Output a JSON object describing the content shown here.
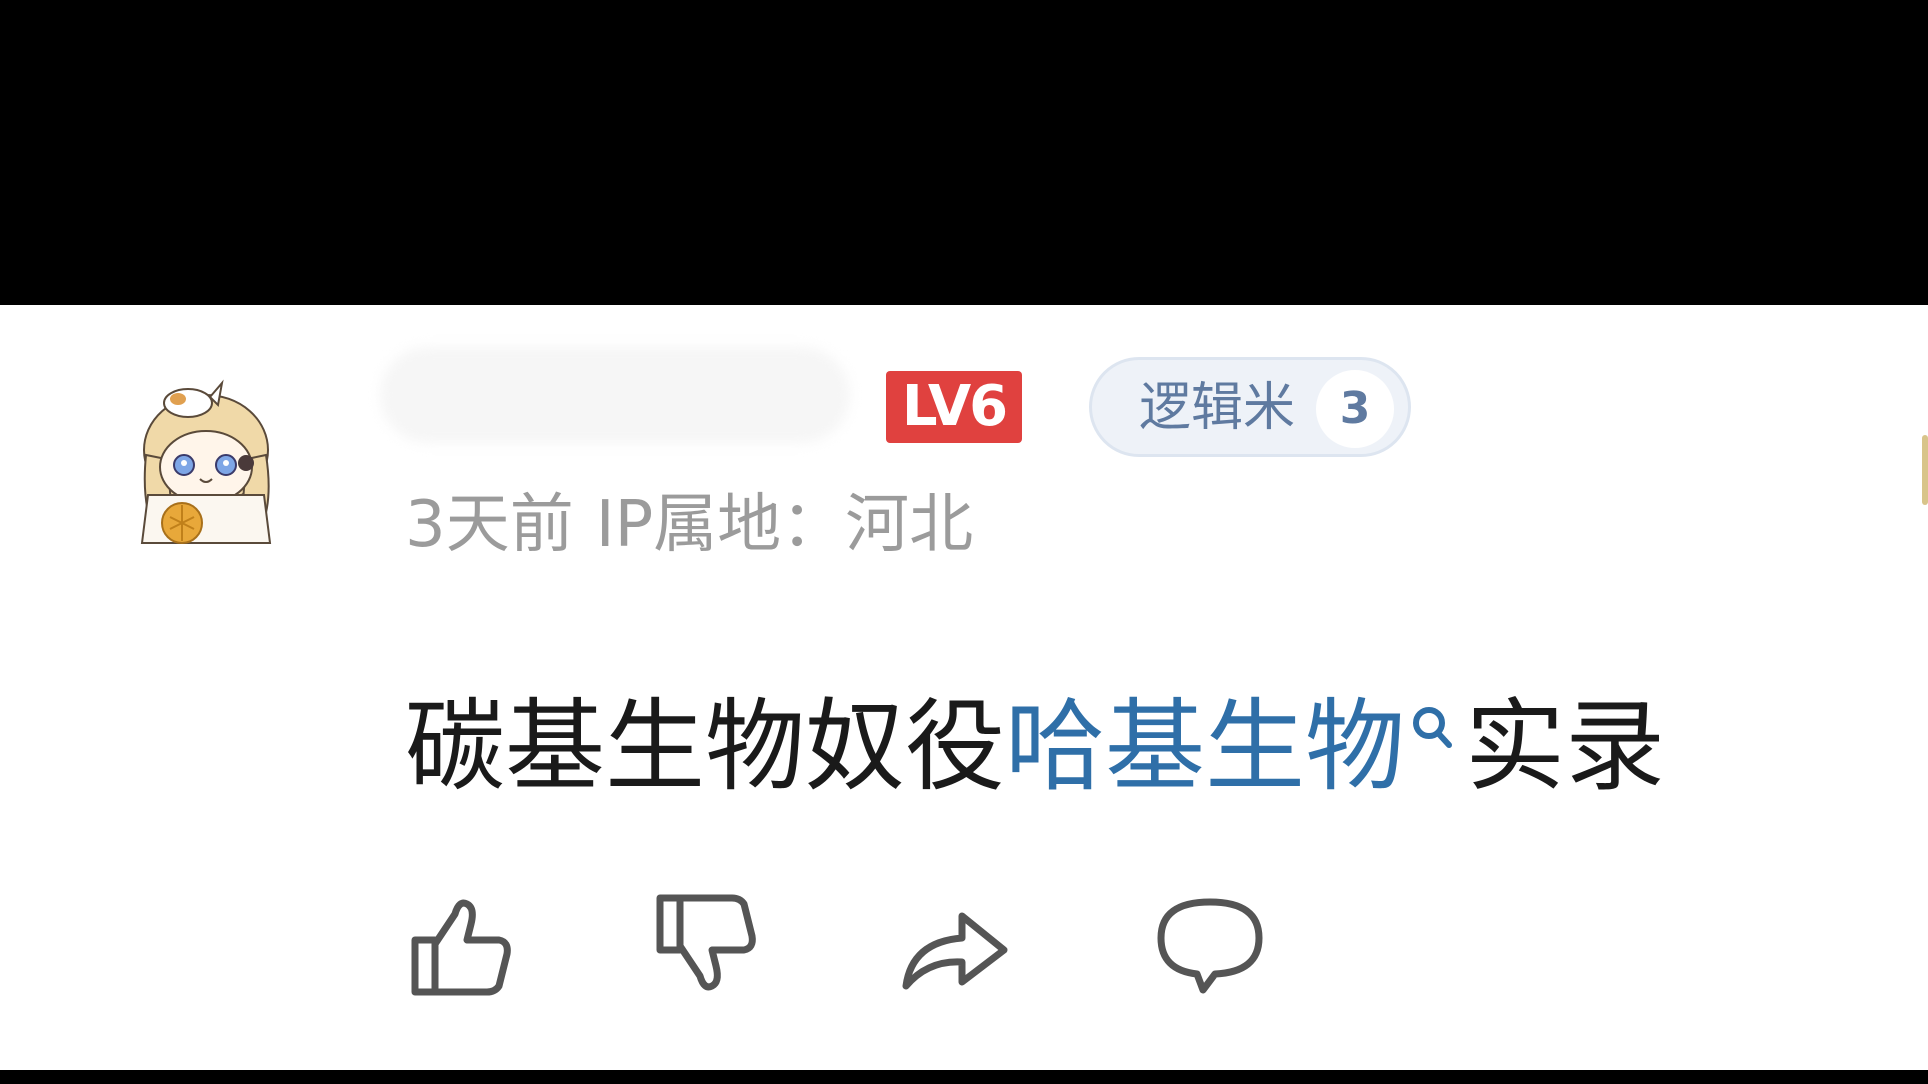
{
  "comment": {
    "username": "",
    "level_badge": "LV6",
    "fan_badge": {
      "label": "逻辑米",
      "level": "3"
    },
    "meta": {
      "time": "3天前",
      "ip_location": "IP属地：河北"
    },
    "text": {
      "before_link": "碳基生物奴役",
      "link": "哈基生物",
      "after_link": "实录"
    }
  },
  "actions": {
    "like_icon": "thumbs-up-icon",
    "dislike_icon": "thumbs-down-icon",
    "share_icon": "share-arrow-icon",
    "reply_icon": "speech-bubble-icon"
  },
  "colors": {
    "link": "#2f6fa8",
    "level_badge": "#e0413f",
    "fan_badge_text": "#5f7aa0",
    "meta_text": "#9b9b9b",
    "icon": "#555555"
  }
}
